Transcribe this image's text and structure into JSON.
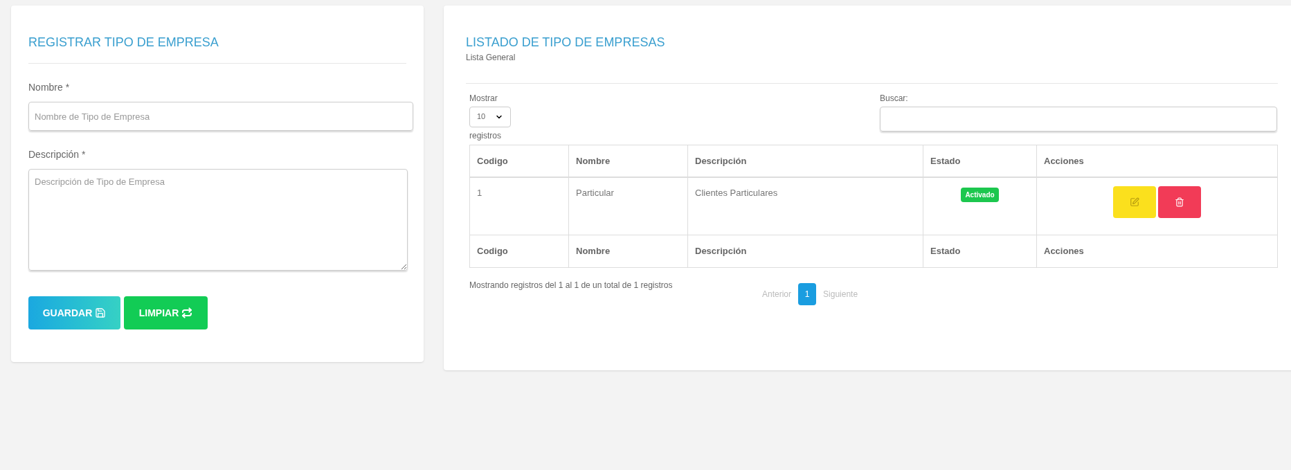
{
  "form": {
    "title": "REGISTRAR TIPO DE EMPRESA",
    "fields": [
      {
        "kind": "input",
        "label": "Nombre *",
        "placeholder": "Nombre de Tipo de Empresa"
      },
      {
        "kind": "textarea",
        "label": "Descripción *",
        "placeholder": "Descripción de Tipo de Empresa"
      }
    ],
    "buttons": [
      {
        "kind": "save",
        "label": "GUARDAR"
      },
      {
        "kind": "clear",
        "label": "LIMPIAR"
      }
    ]
  },
  "list": {
    "title": "LISTADO DE TIPO DE EMPRESAS",
    "subtitle": "Lista General",
    "length": {
      "before": "Mostrar",
      "value": "10",
      "after": "registros"
    },
    "search": {
      "label": "Buscar:"
    },
    "columns": [
      "Codigo",
      "Nombre",
      "Descripción",
      "Estado",
      "Acciones"
    ],
    "rows": [
      {
        "codigo": "1",
        "nombre": "Particular",
        "descripcion": "Clientes Particulares",
        "status": {
          "label": "Activado",
          "active": true
        }
      }
    ],
    "footer_columns": [
      "Codigo",
      "Nombre",
      "Descripción",
      "Estado",
      "Acciones"
    ],
    "info": "Mostrando registros del 1 al 1 de un total de 1 registros",
    "pagination": {
      "previous": "Anterior",
      "pages": [
        {
          "label": "1",
          "selected": true
        }
      ],
      "next": "Siguiente"
    }
  }
}
